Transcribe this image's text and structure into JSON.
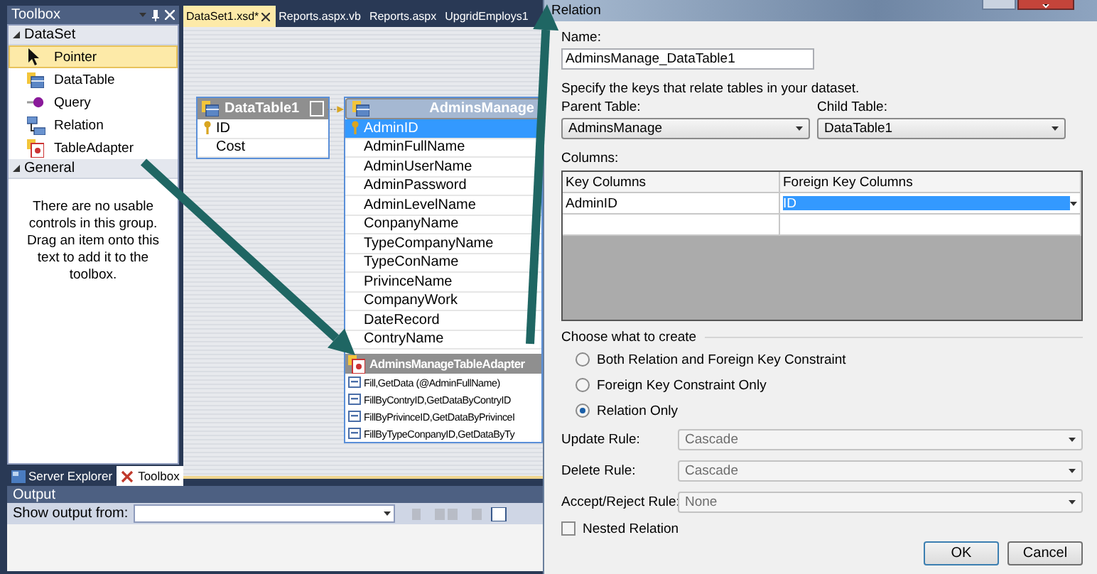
{
  "toolbox": {
    "title": "Toolbox",
    "groups": [
      {
        "label": "DataSet",
        "expanded": true,
        "items": [
          {
            "label": "Pointer",
            "selected": true
          },
          {
            "label": "DataTable",
            "selected": false
          },
          {
            "label": "Query",
            "selected": false
          },
          {
            "label": "Relation",
            "selected": false
          },
          {
            "label": "TableAdapter",
            "selected": false
          }
        ]
      },
      {
        "label": "General",
        "expanded": true,
        "message": "There are no usable controls in this group. Drag an item onto this text to add it to the toolbox."
      }
    ]
  },
  "panel_tabs": [
    {
      "label": "Server Explorer",
      "selected": false
    },
    {
      "label": "Toolbox",
      "selected": true
    }
  ],
  "document_tabs": [
    {
      "label": "DataSet1.xsd*",
      "selected": true
    },
    {
      "label": "Reports.aspx.vb",
      "selected": false
    },
    {
      "label": "Reports.aspx",
      "selected": false
    },
    {
      "label": "UpgridEmploys1",
      "selected": false
    }
  ],
  "designer": {
    "tables": [
      {
        "name": "DataTable1",
        "columns": [
          {
            "label": "ID",
            "key": true,
            "selected": false
          },
          {
            "label": "Cost",
            "key": false,
            "selected": false
          }
        ]
      },
      {
        "name": "AdminsManage",
        "columns": [
          {
            "label": "AdminID",
            "key": true,
            "selected": true
          },
          {
            "label": "AdminFullName",
            "key": false,
            "selected": false
          },
          {
            "label": "AdminUserName",
            "key": false,
            "selected": false
          },
          {
            "label": "AdminPassword",
            "key": false,
            "selected": false
          },
          {
            "label": "AdminLevelName",
            "key": false,
            "selected": false
          },
          {
            "label": "ConpanyName",
            "key": false,
            "selected": false
          },
          {
            "label": "TypeCompanyName",
            "key": false,
            "selected": false
          },
          {
            "label": "TypeConName",
            "key": false,
            "selected": false
          },
          {
            "label": "PrivinceName",
            "key": false,
            "selected": false
          },
          {
            "label": "CompanyWork",
            "key": false,
            "selected": false
          },
          {
            "label": "DateRecord",
            "key": false,
            "selected": false
          },
          {
            "label": "ContryName",
            "key": false,
            "selected": false
          }
        ],
        "adapter": {
          "name": "AdminsManageTableAdapter",
          "queries": [
            "Fill,GetData (@AdminFullName)",
            "FillByContryID,GetDataByContryID",
            "FillByPrivinceID,GetDataByPrivinceI",
            "FillByTypeConpanyID,GetDataByTy"
          ]
        }
      }
    ]
  },
  "output": {
    "title": "Output",
    "label": "Show output from:"
  },
  "dialog": {
    "title": "Relation",
    "name_label": "Name:",
    "name_value": "AdminsManage_DataTable1",
    "hint": "Specify the keys that relate tables in your dataset.",
    "parent_table": {
      "label": "Parent Table:",
      "value": "AdminsManage"
    },
    "child_table": {
      "label": "Child Table:",
      "value": "DataTable1"
    },
    "columns_label": "Columns:",
    "grid_columns": [
      "Key Columns",
      "Foreign Key Columns"
    ],
    "grid_rows": [
      {
        "key": "AdminID",
        "foreign": "ID",
        "selected": true
      }
    ],
    "create_label": "Choose what to create",
    "options": [
      {
        "label": "Both Relation and Foreign Key Constraint",
        "selected": false
      },
      {
        "label": "Foreign Key Constraint Only",
        "selected": false
      },
      {
        "label": "Relation Only",
        "selected": true
      }
    ],
    "rules": [
      {
        "label": "Update Rule:",
        "value": "Cascade",
        "disabled": true
      },
      {
        "label": "Delete Rule:",
        "value": "Cascade",
        "disabled": true
      },
      {
        "label": "Accept/Reject Rule:",
        "value": "None",
        "disabled": true
      }
    ],
    "nested": {
      "label": "Nested Relation",
      "checked": false
    },
    "buttons": [
      "OK",
      "Cancel"
    ]
  }
}
